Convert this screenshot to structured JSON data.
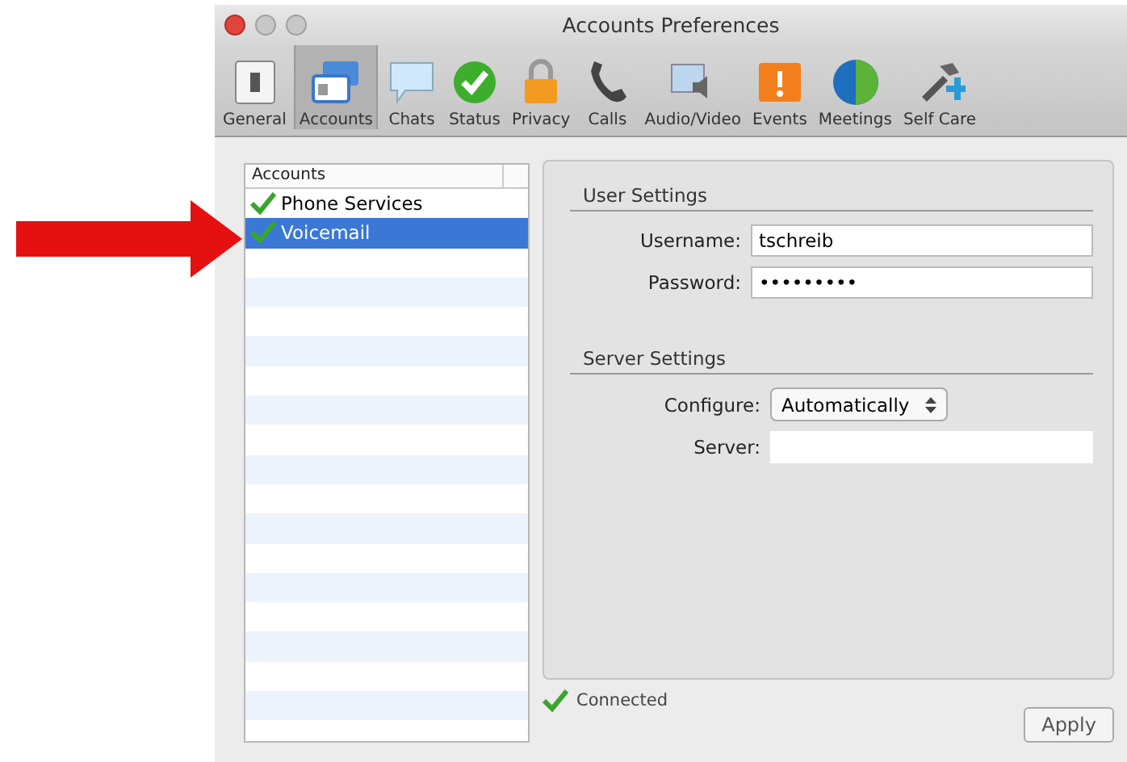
{
  "window": {
    "title": "Accounts Preferences"
  },
  "toolbar": [
    {
      "label": "General",
      "kind": "switch",
      "selected": false
    },
    {
      "label": "Accounts",
      "kind": "cards",
      "selected": true
    },
    {
      "label": "Chats",
      "kind": "bubble",
      "selected": false
    },
    {
      "label": "Status",
      "kind": "check",
      "selected": false
    },
    {
      "label": "Privacy",
      "kind": "lock",
      "selected": false
    },
    {
      "label": "Calls",
      "kind": "phone",
      "selected": false
    },
    {
      "label": "Audio/Video",
      "kind": "monitor",
      "selected": false
    },
    {
      "label": "Events",
      "kind": "alert",
      "selected": false
    },
    {
      "label": "Meetings",
      "kind": "globe",
      "selected": false
    },
    {
      "label": "Self Care",
      "kind": "tools",
      "selected": false
    }
  ],
  "accounts": {
    "header": "Accounts",
    "items": [
      {
        "name": "Phone Services",
        "checked": true,
        "selected": false
      },
      {
        "name": "Voicemail",
        "checked": true,
        "selected": true
      }
    ]
  },
  "user_settings": {
    "title": "User Settings",
    "username": {
      "label": "Username:",
      "value": "tschreib"
    },
    "password": {
      "label": "Password:",
      "value": "•••••••••"
    }
  },
  "server_settings": {
    "title": "Server Settings",
    "configure": {
      "label": "Configure:",
      "value": "Automatically"
    },
    "server": {
      "label": "Server:"
    }
  },
  "status": {
    "text": "Connected",
    "connected": true
  },
  "apply_button": "Apply"
}
